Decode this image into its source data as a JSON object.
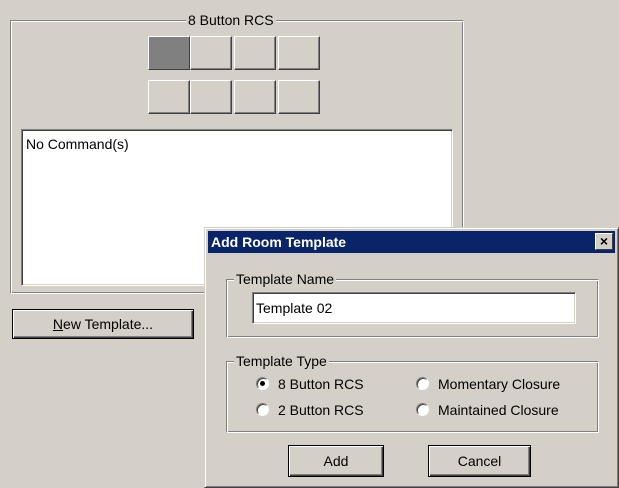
{
  "main": {
    "group_title": "8 Button RCS",
    "grid_buttons": [
      {
        "active": true
      },
      {
        "active": false
      },
      {
        "active": false
      },
      {
        "active": false
      },
      {
        "active": false
      },
      {
        "active": false
      },
      {
        "active": false
      },
      {
        "active": false
      }
    ],
    "command_list": [
      "No Command(s)"
    ],
    "new_template_label_accel": "N",
    "new_template_label_rest": "ew Template..."
  },
  "dialog": {
    "title": "Add Room Template",
    "close_glyph": "×",
    "name_group_label": "Template Name",
    "name_value": "Template 02",
    "type_group_label": "Template Type",
    "types": [
      {
        "label": "8 Button RCS",
        "checked": true
      },
      {
        "label": "2 Button RCS",
        "checked": false
      },
      {
        "label": "Momentary Closure",
        "checked": false
      },
      {
        "label": "Maintained Closure",
        "checked": false
      }
    ],
    "add_label": "Add",
    "cancel_label": "Cancel"
  }
}
